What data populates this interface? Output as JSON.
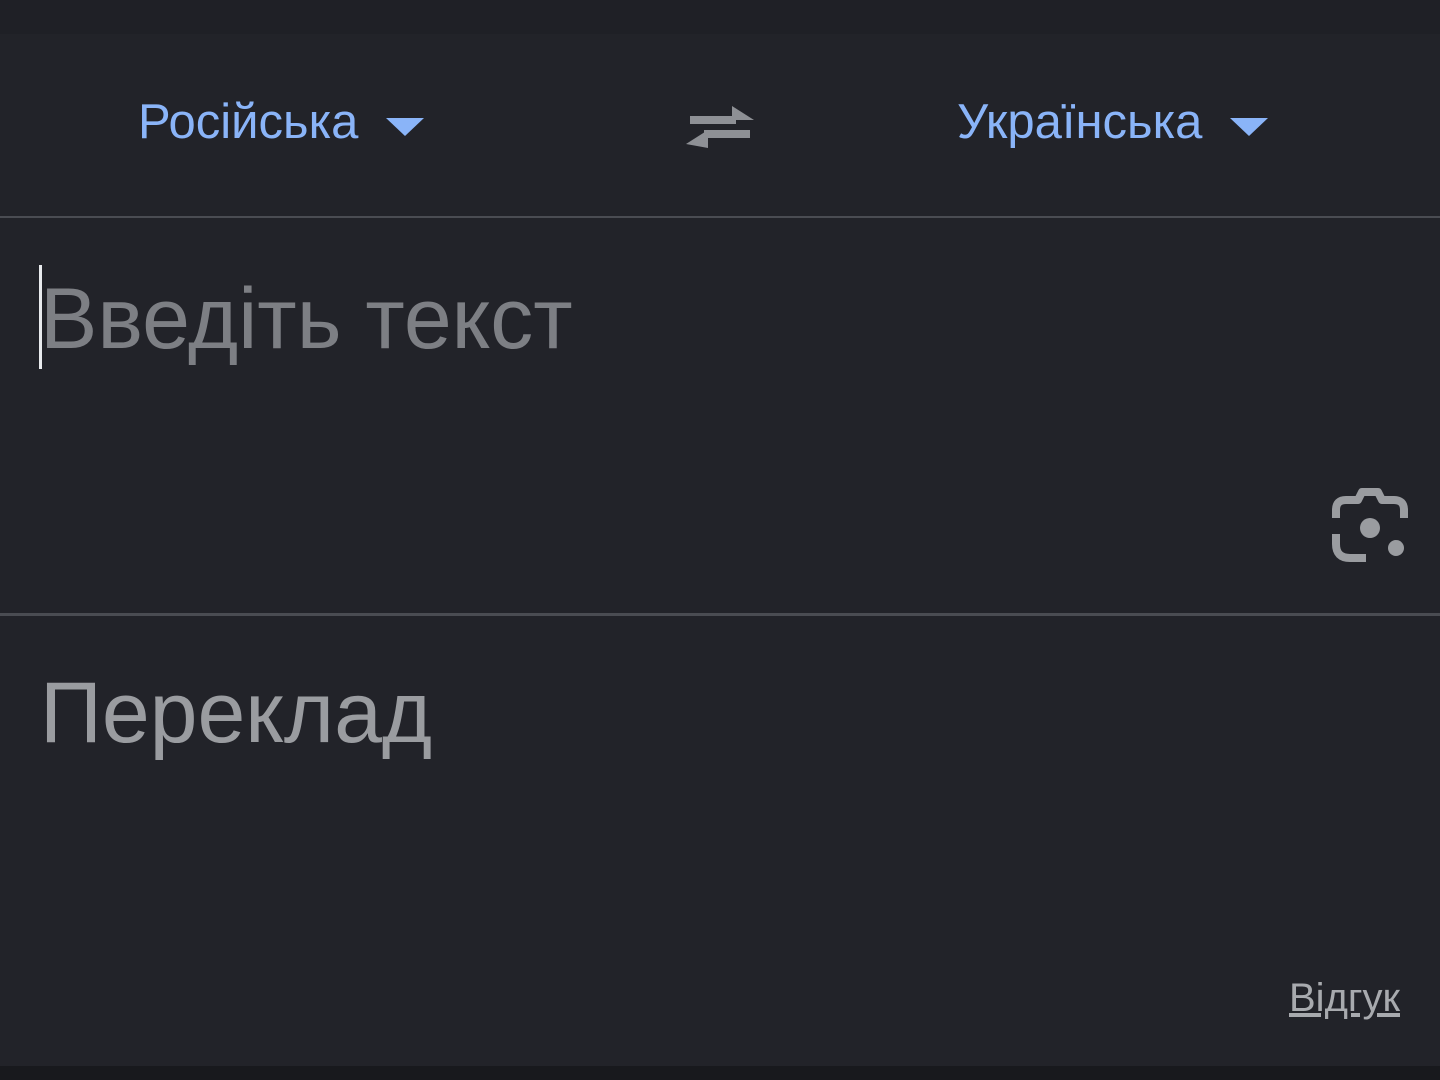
{
  "language_bar": {
    "source_language": "Російська",
    "target_language": "Українська"
  },
  "input": {
    "placeholder": "Введіть текст",
    "value": ""
  },
  "output": {
    "placeholder": "Переклад"
  },
  "feedback_link": "Відгук",
  "colors": {
    "background": "#222329",
    "accent": "#8ab4f8",
    "placeholder": "#7d7f84",
    "divider": "#4a4c52"
  },
  "icons": {
    "dropdown": "chevron-down-icon",
    "swap": "swap-languages-icon",
    "camera": "lens-camera-icon"
  }
}
